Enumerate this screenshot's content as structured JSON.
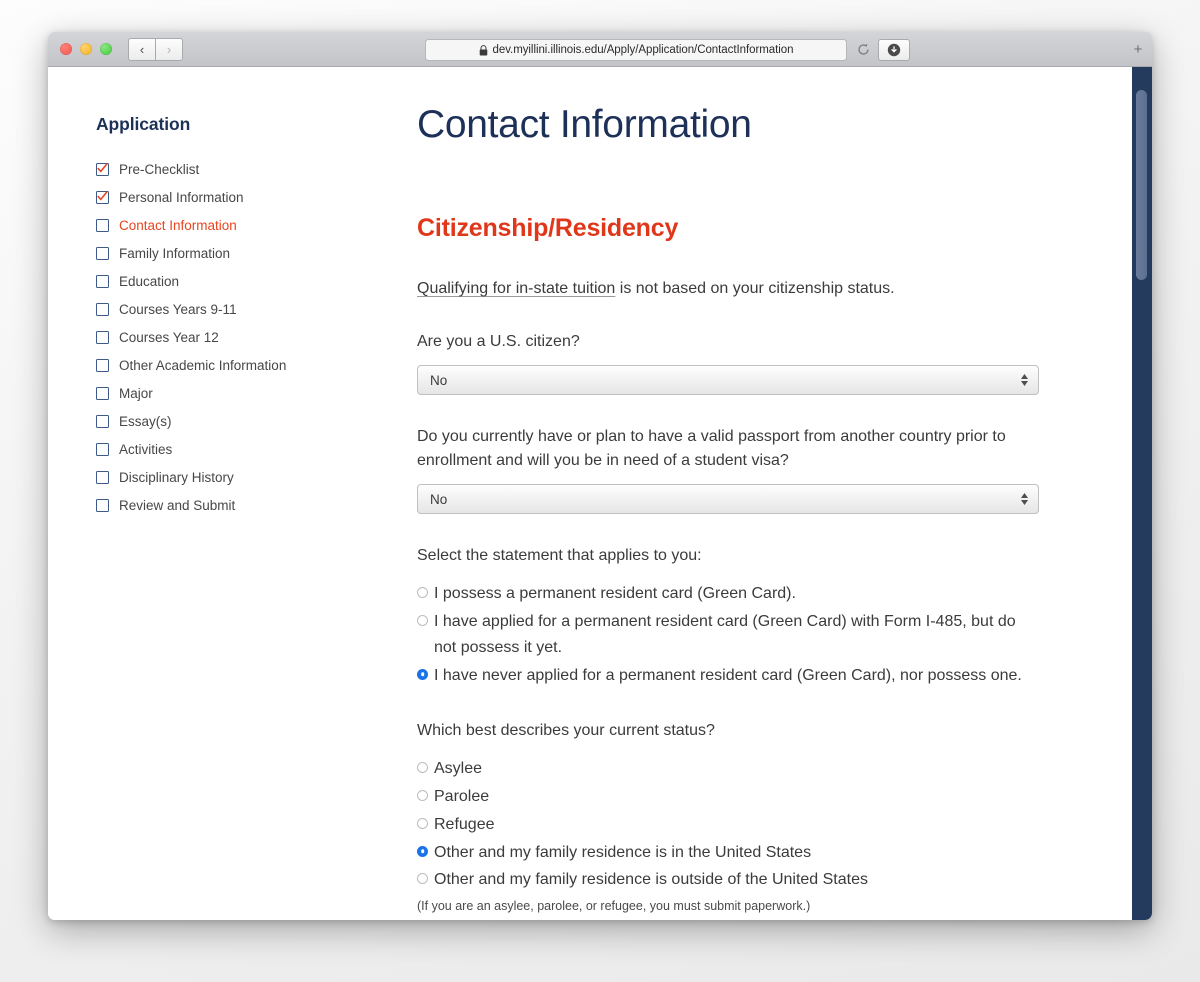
{
  "browser": {
    "url": "dev.myillini.illinois.edu/Apply/Application/ContactInformation",
    "lock_icon": "lock-icon",
    "back_icon": "chevron-left-icon",
    "forward_icon": "chevron-right-icon",
    "reload_icon": "reload-icon",
    "download_icon": "download-icon",
    "new_tab_icon": "plus-icon",
    "traffic_lights": [
      "close-button",
      "minimize-button",
      "zoom-button"
    ]
  },
  "sidebar": {
    "title": "Application",
    "items": [
      {
        "label": "Pre-Checklist",
        "checked": true,
        "active": false
      },
      {
        "label": "Personal Information",
        "checked": true,
        "active": false
      },
      {
        "label": "Contact Information",
        "checked": false,
        "active": true
      },
      {
        "label": "Family Information",
        "checked": false,
        "active": false
      },
      {
        "label": "Education",
        "checked": false,
        "active": false
      },
      {
        "label": "Courses Years 9-11",
        "checked": false,
        "active": false
      },
      {
        "label": "Courses Year 12",
        "checked": false,
        "active": false
      },
      {
        "label": "Other Academic Information",
        "checked": false,
        "active": false
      },
      {
        "label": "Major",
        "checked": false,
        "active": false
      },
      {
        "label": "Essay(s)",
        "checked": false,
        "active": false
      },
      {
        "label": "Activities",
        "checked": false,
        "active": false
      },
      {
        "label": "Disciplinary History",
        "checked": false,
        "active": false
      },
      {
        "label": "Review and Submit",
        "checked": false,
        "active": false
      }
    ]
  },
  "main": {
    "page_title": "Contact Information",
    "section_title": "Citizenship/Residency",
    "intro_link_text": "Qualifying for in-state tuition",
    "intro_rest_text": " is not based on your citizenship status.",
    "citizen_question": "Are you a U.S. citizen?",
    "citizen_value": "No",
    "passport_question": "Do you currently have or plan to have a valid passport from another country prior to enrollment and will you be in need of a student visa?",
    "passport_value": "No",
    "statement_question": "Select the statement that applies to you:",
    "statement_options": [
      {
        "label": "I possess a permanent resident card (Green Card).",
        "selected": false
      },
      {
        "label": "I have applied for a permanent resident card (Green Card) with Form I-485, but do not possess it yet.",
        "selected": false
      },
      {
        "label": "I have never applied for a permanent resident card (Green Card), nor possess one.",
        "selected": true
      }
    ],
    "status_question": "Which best describes your current status?",
    "status_options": [
      {
        "label": "Asylee",
        "selected": false
      },
      {
        "label": "Parolee",
        "selected": false
      },
      {
        "label": "Refugee",
        "selected": false
      },
      {
        "label": "Other and my family residence is in the United States",
        "selected": true
      },
      {
        "label": "Other and my family residence is outside of the United States",
        "selected": false
      }
    ],
    "status_note": "(If you are an asylee, parolee, or refugee, you must submit paperwork.)"
  },
  "colors": {
    "brand_navy": "#1d3057",
    "brand_orange": "#e0371a",
    "active_link": "#e8451f",
    "radio_selected": "#1a73e8",
    "scrollbar_track": "#243b5e"
  }
}
